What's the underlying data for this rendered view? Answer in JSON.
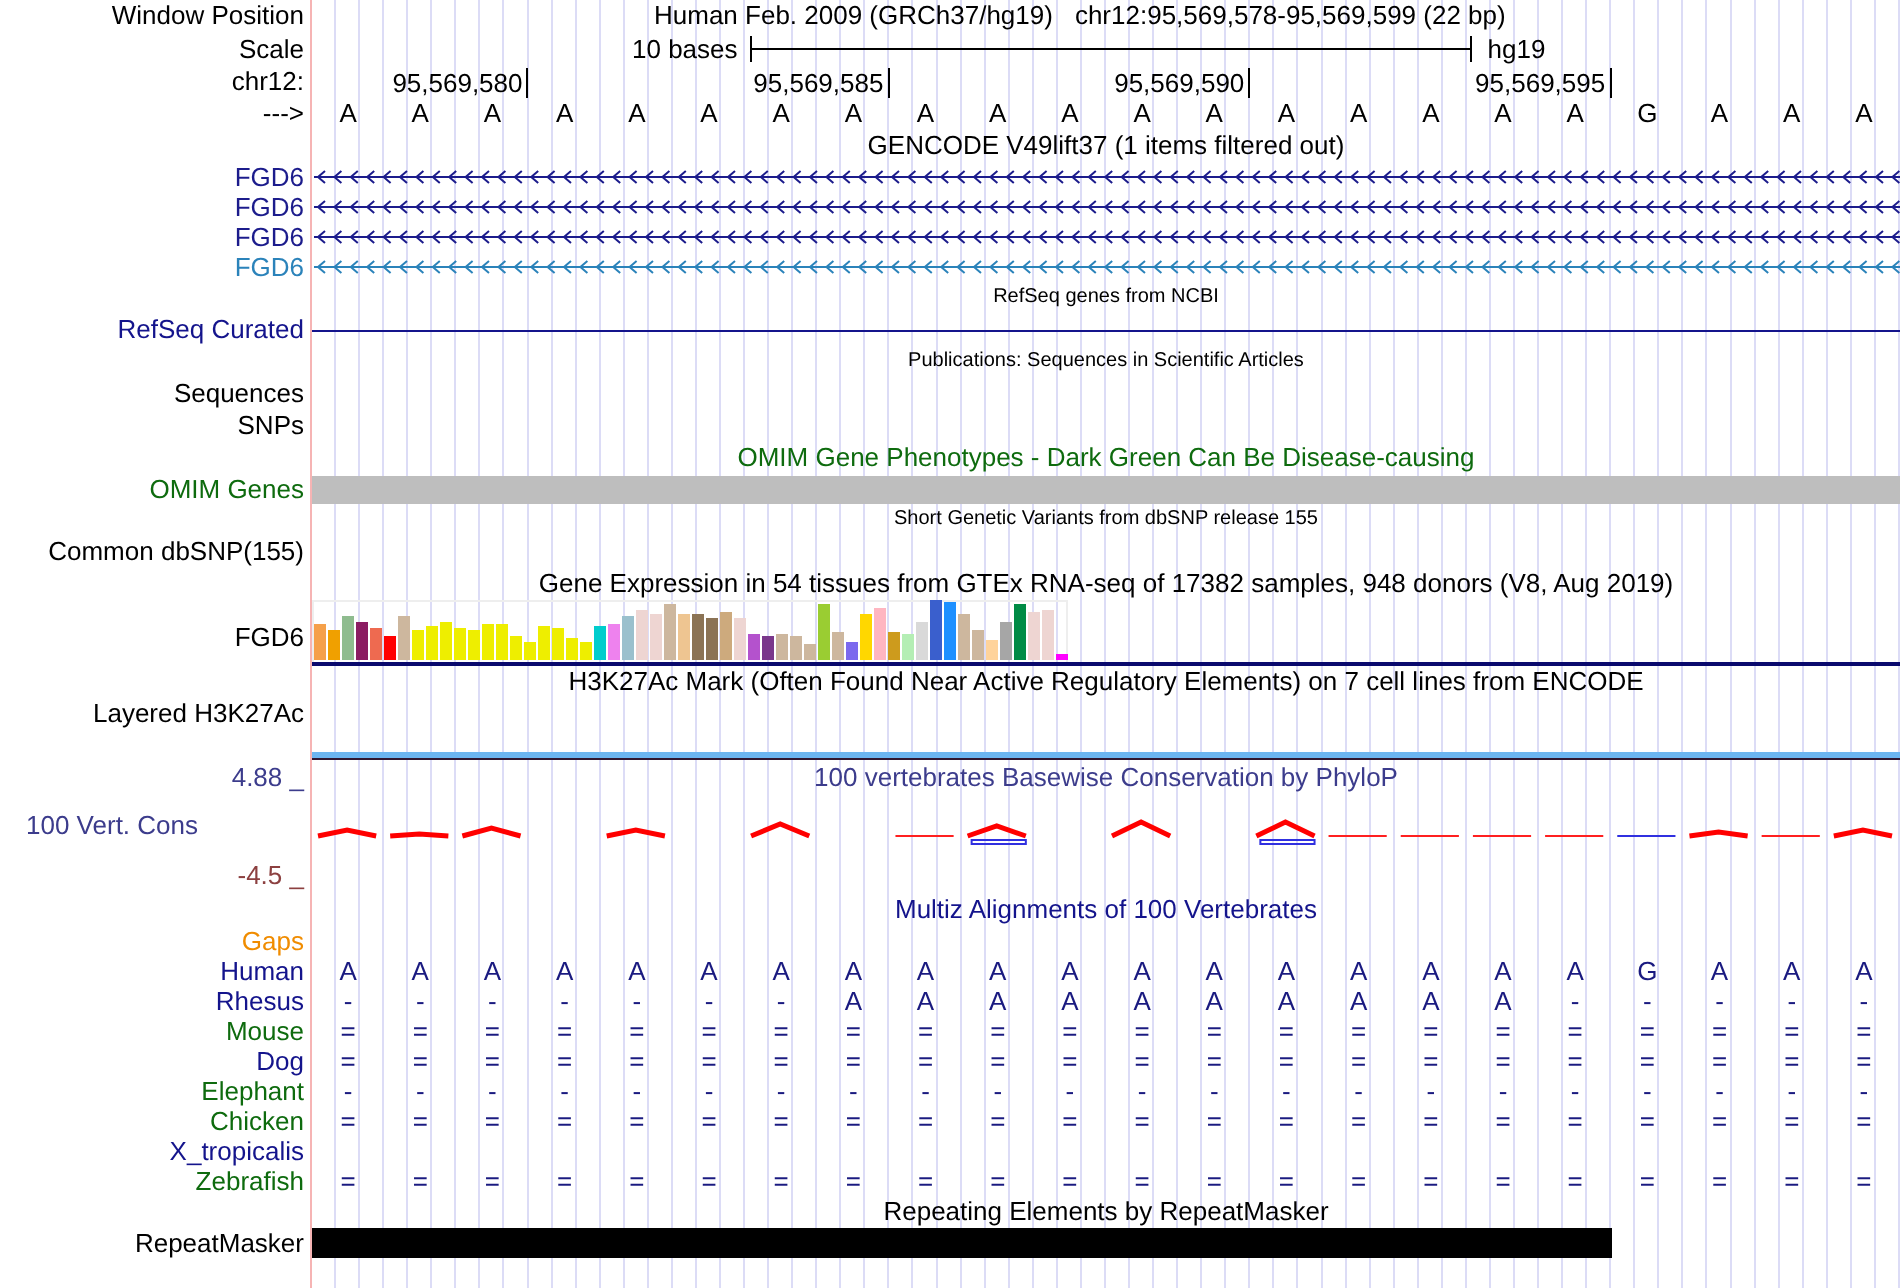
{
  "window_position": {
    "label": "Window Position",
    "assembly": "Human Feb. 2009 (GRCh37/hg19)",
    "position": "chr12:95,569,578-95,569,599 (22 bp)"
  },
  "scale": {
    "label": "Scale",
    "span": "10 bases",
    "assembly": "hg19"
  },
  "ruler": {
    "label": "chr12:",
    "ticks": [
      "95,569,580",
      "95,569,585",
      "95,569,590",
      "95,569,595"
    ]
  },
  "sequence": {
    "label": "--->",
    "bases": [
      "A",
      "A",
      "A",
      "A",
      "A",
      "A",
      "A",
      "A",
      "A",
      "A",
      "A",
      "A",
      "A",
      "A",
      "A",
      "A",
      "A",
      "A",
      "G",
      "A",
      "A",
      "A"
    ]
  },
  "tracks": [
    {
      "kind": "title",
      "text": "GENCODE V49lift37 (1 items filtered out)",
      "color": "#000000"
    },
    {
      "kind": "gene",
      "label": "FGD6",
      "color": "#1c1c8c"
    },
    {
      "kind": "gene",
      "label": "FGD6",
      "color": "#1c1c8c"
    },
    {
      "kind": "gene",
      "label": "FGD6",
      "color": "#1c1c8c"
    },
    {
      "kind": "gene",
      "label": "FGD6",
      "color": "#2b83ba"
    },
    {
      "kind": "caption",
      "text": "RefSeq genes from NCBI",
      "color": "#000000"
    },
    {
      "kind": "line",
      "label": "RefSeq Curated",
      "color": "#14148c"
    },
    {
      "kind": "caption",
      "text": "Publications: Sequences in Scientific Articles",
      "color": "#000000"
    },
    {
      "kind": "label",
      "label": "Sequences",
      "color": "#000000"
    },
    {
      "kind": "label",
      "label": "SNPs",
      "color": "#000000"
    },
    {
      "kind": "title",
      "text": "OMIM Gene Phenotypes - Dark Green Can Be Disease-causing",
      "color": "#0e6b0e"
    },
    {
      "kind": "block",
      "label": "OMIM Genes",
      "color": "#0e6b0e"
    },
    {
      "kind": "caption",
      "text": "Short Genetic Variants from dbSNP release 155",
      "color": "#000000"
    },
    {
      "kind": "label",
      "label": "Common dbSNP(155)",
      "color": "#000000"
    },
    {
      "kind": "title",
      "text": "Gene Expression in 54 tissues from GTEx RNA-seq of 17382 samples, 948 donors (V8, Aug 2019)",
      "color": "#000000"
    },
    {
      "kind": "expression",
      "label": "FGD6",
      "color": "#000000"
    },
    {
      "kind": "title",
      "text": "H3K27Ac Mark (Often Found Near Active Regulatory Elements) on 7 cell lines from ENCODE",
      "color": "#000000"
    },
    {
      "kind": "layered",
      "label": "Layered H3K27Ac",
      "color": "#000000"
    },
    {
      "kind": "conservation",
      "title": "100 vertebrates Basewise Conservation by PhyloP",
      "label": "100 Vert. Cons",
      "max": "4.88 _",
      "min": "-4.5 _",
      "color": "#3c3c8c"
    },
    {
      "kind": "title",
      "text": "Multiz Alignments of 100 Vertebrates",
      "color": "#14148c"
    },
    {
      "kind": "species",
      "label": "Gaps",
      "color": "#f08c00"
    },
    {
      "kind": "species",
      "label": "Human",
      "color": "#14148c",
      "cells": [
        "A",
        "A",
        "A",
        "A",
        "A",
        "A",
        "A",
        "A",
        "A",
        "A",
        "A",
        "A",
        "A",
        "A",
        "A",
        "A",
        "A",
        "A",
        "G",
        "A",
        "A",
        "A"
      ]
    },
    {
      "kind": "species",
      "label": "Rhesus",
      "color": "#14148c",
      "cells": [
        "-",
        "-",
        "-",
        "-",
        "-",
        "-",
        "-",
        "A",
        "A",
        "A",
        "A",
        "A",
        "A",
        "A",
        "A",
        "A",
        "A",
        "-",
        "-",
        "-",
        "-",
        "-"
      ]
    },
    {
      "kind": "species",
      "label": "Mouse",
      "color": "#0e6b0e",
      "cells": [
        "=",
        "=",
        "=",
        "=",
        "=",
        "=",
        "=",
        "=",
        "=",
        "=",
        "=",
        "=",
        "=",
        "=",
        "=",
        "=",
        "=",
        "=",
        "=",
        "=",
        "=",
        "="
      ]
    },
    {
      "kind": "species",
      "label": "Dog",
      "color": "#14148c",
      "cells": [
        "=",
        "=",
        "=",
        "=",
        "=",
        "=",
        "=",
        "=",
        "=",
        "=",
        "=",
        "=",
        "=",
        "=",
        "=",
        "=",
        "=",
        "=",
        "=",
        "=",
        "=",
        "="
      ]
    },
    {
      "kind": "species",
      "label": "Elephant",
      "color": "#0e6b0e",
      "cells": [
        "-",
        "-",
        "-",
        "-",
        "-",
        "-",
        "-",
        "-",
        "-",
        "-",
        "-",
        "-",
        "-",
        "-",
        "-",
        "-",
        "-",
        "-",
        "-",
        "-",
        "-",
        "-"
      ]
    },
    {
      "kind": "species",
      "label": "Chicken",
      "color": "#0e6b0e",
      "cells": [
        "=",
        "=",
        "=",
        "=",
        "=",
        "=",
        "=",
        "=",
        "=",
        "=",
        "=",
        "=",
        "=",
        "=",
        "=",
        "=",
        "=",
        "=",
        "=",
        "=",
        "=",
        "="
      ]
    },
    {
      "kind": "species",
      "label": "X_tropicalis",
      "color": "#14148c"
    },
    {
      "kind": "species",
      "label": "Zebrafish",
      "color": "#0e6b0e",
      "cells": [
        "=",
        "=",
        "=",
        "=",
        "=",
        "=",
        "=",
        "=",
        "=",
        "=",
        "=",
        "=",
        "=",
        "=",
        "=",
        "=",
        "=",
        "=",
        "=",
        "=",
        "=",
        "="
      ]
    },
    {
      "kind": "title",
      "text": "Repeating Elements by RepeatMasker",
      "color": "#000000"
    },
    {
      "kind": "repeat",
      "label": "RepeatMasker",
      "color": "#000000"
    }
  ]
}
